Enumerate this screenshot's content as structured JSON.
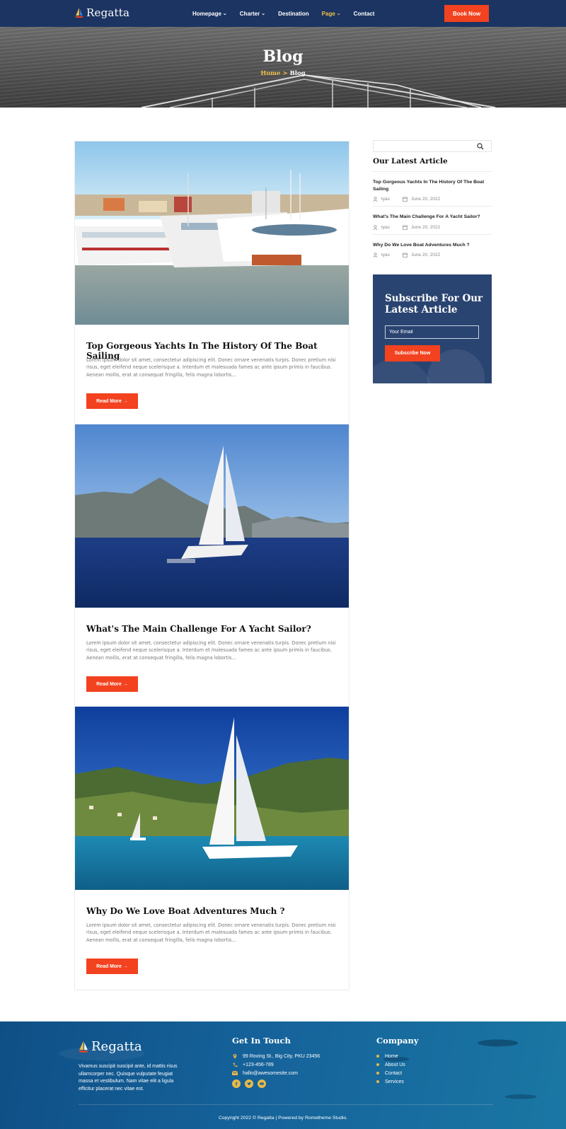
{
  "brand": {
    "name": "Regatta"
  },
  "colors": {
    "navy": "#1c3461",
    "accent": "#f2421f",
    "gold": "#f0c24a"
  },
  "nav": {
    "items": [
      {
        "label": "Homepage",
        "dropdown": true
      },
      {
        "label": "Charter",
        "dropdown": true
      },
      {
        "label": "Destination",
        "dropdown": false
      },
      {
        "label": "Page",
        "dropdown": true,
        "active": true
      },
      {
        "label": "Contact",
        "dropdown": false
      }
    ],
    "book_label": "Book Now"
  },
  "hero": {
    "title": "Blog",
    "breadcrumb_home": "Home",
    "breadcrumb_sep": ">",
    "breadcrumb_current": "Blog"
  },
  "posts": [
    {
      "title": "Top Gorgeous Yachts In The History Of The Boat Sailing",
      "excerpt": "Lorem ipsum dolor sit amet, consectetur adipiscing elit. Donec ornare venenatis turpis. Donec pretium nisi risus, eget eleifend neque scelerisque a. Interdum et malesuada fames ac ante ipsum primis in faucibus. Aenean mollis, erat at consequat fringilla, felis magna lobortis...",
      "button": "Read More →",
      "image": "marina-yachts"
    },
    {
      "title": "What's The Main Challenge For A Yacht Sailor?",
      "excerpt": "Lorem ipsum dolor sit amet, consectetur adipiscing elit. Donec ornare venenatis turpis. Donec pretium nisi risus, eget eleifend neque scelerisque a. Interdum et malesuada fames ac ante ipsum primis in faucibus. Aenean mollis, erat at consequat fringilla, felis magna lobortis...",
      "button": "Read More →",
      "image": "sailboat-mountains"
    },
    {
      "title": "Why Do We Love Boat Adventures Much ?",
      "excerpt": "Lorem ipsum dolor sit amet, consectetur adipiscing elit. Donec ornare venenatis turpis. Donec pretium nisi risus, eget eleifend neque scelerisque a. Interdum et malesuada fames ac ante ipsum primis in faucibus. Aenean mollis, erat at consequat fringilla, felis magna lobortis...",
      "button": "Read More →",
      "image": "sailboat-island"
    }
  ],
  "sidebar": {
    "search_placeholder": "",
    "latest_heading": "Our Latest Article",
    "latest": [
      {
        "title": "Top Gorgeous Yachts In The History Of The Boat Sailing",
        "author": "tyas",
        "date": "June 20, 2022"
      },
      {
        "title": "What's The Main Challenge For A Yacht Sailor?",
        "author": "tyas",
        "date": "June 20, 2022"
      },
      {
        "title": "Why Do We Love Boat Adventures Much ?",
        "author": "tyas",
        "date": "June 20, 2022"
      }
    ],
    "subscribe": {
      "title": "Subscribe For Our Latest Article",
      "email_placeholder": "Your Email",
      "button": "Subscribe Now"
    }
  },
  "footer": {
    "about": "Vivamus suscipit suscipit ante, id mattis risus ullamcorper nec. Quisque vulputate feugiat massa et vestibulum. Nam vitae elit a ligula efficitur placerat nec vitae est.",
    "contact_title": "Get In Touch",
    "contact": {
      "address": "99 Roving St., Big City, PKU 23456",
      "phone": "+123-456-789",
      "email": "hallo@awesomesite.com"
    },
    "socials": [
      "facebook-icon",
      "twitter-icon",
      "youtube-icon"
    ],
    "company_title": "Company",
    "company_links": [
      "Home",
      "About Us",
      "Contact",
      "Services"
    ],
    "copyright": "Copyright 2022 © Regatta | Powered by Rometheme Studio."
  }
}
